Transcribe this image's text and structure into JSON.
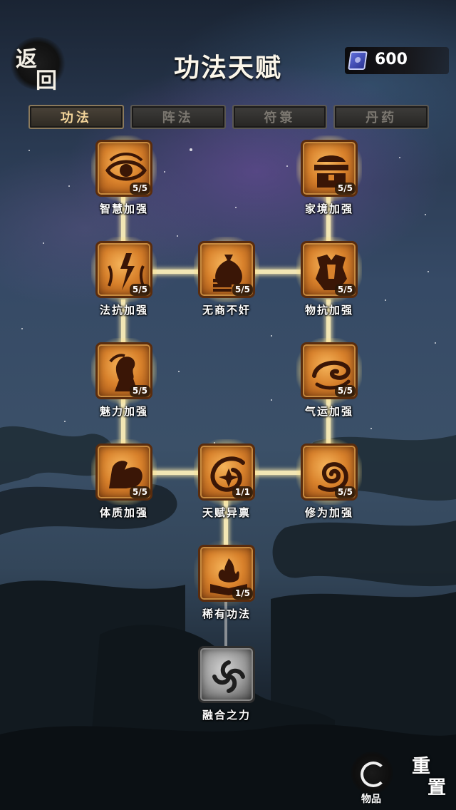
{
  "header": {
    "back_char_1": "返",
    "back_char_2": "回",
    "title": "功法天赋",
    "currency_icon": "blue-book-icon",
    "currency_amount": "600"
  },
  "tabs": [
    {
      "label": "功法",
      "active": true
    },
    {
      "label": "阵法",
      "active": false
    },
    {
      "label": "符箓",
      "active": false
    },
    {
      "label": "丹药",
      "active": false
    }
  ],
  "talents": {
    "wisdom": {
      "name": "智慧加强",
      "level": "5/5",
      "icon": "eye-icon"
    },
    "home": {
      "name": "家境加强",
      "level": "5/5",
      "icon": "treasure-chest-icon"
    },
    "magic_resist": {
      "name": "法抗加强",
      "level": "5/5",
      "icon": "lightning-icon"
    },
    "no_trader": {
      "name": "无商不奸",
      "level": "5/5",
      "icon": "money-bag-icon"
    },
    "phys_resist": {
      "name": "物抗加强",
      "level": "5/5",
      "icon": "armor-icon"
    },
    "charm": {
      "name": "魅力加强",
      "level": "5/5",
      "icon": "woman-profile-icon"
    },
    "luck": {
      "name": "气运加强",
      "level": "5/5",
      "icon": "swirl-cloud-icon"
    },
    "physique": {
      "name": "体质加强",
      "level": "5/5",
      "icon": "muscle-arm-icon"
    },
    "gifted": {
      "name": "天赋异禀",
      "level": "1/1",
      "icon": "spiral-star-icon"
    },
    "cultivation": {
      "name": "修为加强",
      "level": "5/5",
      "icon": "spiral-energy-icon"
    },
    "rare_skill": {
      "name": "稀有功法",
      "level": "1/5",
      "icon": "flame-book-icon"
    },
    "fusion": {
      "name": "融合之力",
      "level": "",
      "icon": "vortex-icon"
    }
  },
  "footer": {
    "items_label": "物品",
    "items_icon": "dragon-circle-icon",
    "reset_char_1": "重",
    "reset_char_2": "置"
  },
  "colors": {
    "tile_orange": "#d9822c",
    "glow": "#fff0aa",
    "tab_active_text": "#f2d49a"
  }
}
